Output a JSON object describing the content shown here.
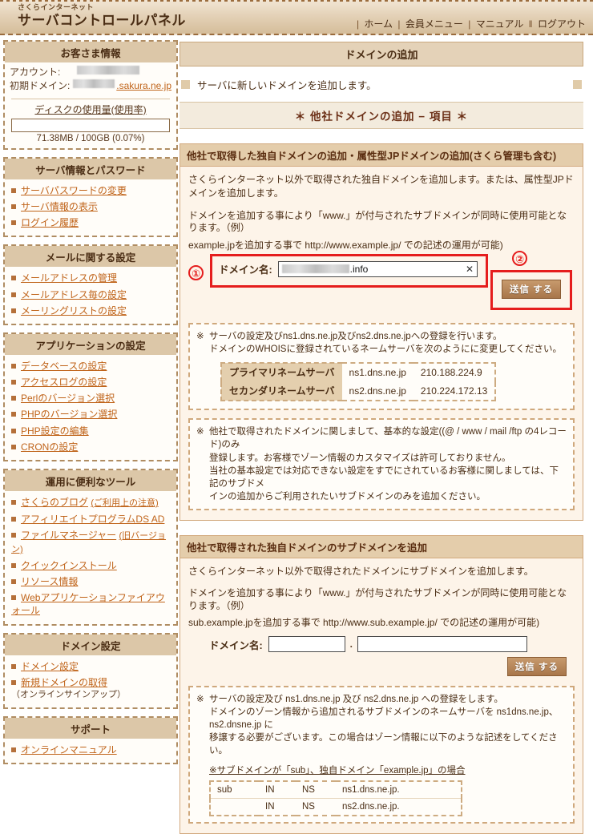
{
  "header": {
    "brand_small": "さくらインターネット",
    "brand_big": "サーバコントロールパネル",
    "nav": [
      {
        "label": "ホーム",
        "sep": "|"
      },
      {
        "label": "会員メニュー",
        "sep": "|"
      },
      {
        "label": "マニュアル",
        "sep": "|"
      },
      {
        "label": "ログアウト",
        "sep": "‖"
      }
    ]
  },
  "sidebar": {
    "customer": {
      "title": "お客さま情報",
      "account_label": "アカウント:",
      "account_value": "",
      "initial_domain_label": "初期ドメイン:",
      "initial_domain_value": "",
      "initial_domain_suffix": ".sakura.ne.jp",
      "disk_title": "ディスクの使用量(使用率)",
      "disk_text": "71.38MB / 100GB (0.07%)",
      "disk_percent": 0.07
    },
    "groups": [
      {
        "title": "サーバ情報とパスワード",
        "items": [
          {
            "label": "サーバパスワードの変更"
          },
          {
            "label": "サーバ情報の表示"
          },
          {
            "label": "ログイン履歴"
          }
        ]
      },
      {
        "title": "メールに関する設定",
        "items": [
          {
            "label": "メールアドレスの管理"
          },
          {
            "label": "メールアドレス毎の設定"
          },
          {
            "label": "メーリングリストの設定"
          }
        ]
      },
      {
        "title": "アプリケーションの設定",
        "items": [
          {
            "label": "データベースの設定"
          },
          {
            "label": "アクセスログの設定"
          },
          {
            "label": "Perlのバージョン選択"
          },
          {
            "label": "PHPのバージョン選択"
          },
          {
            "label": "PHP設定の編集"
          },
          {
            "label": "CRONの設定"
          }
        ]
      },
      {
        "title": "運用に便利なツール",
        "items": [
          {
            "label": "さくらのブログ",
            "note": "(ご利用上の注意)"
          },
          {
            "label": "アフィリエイトプログラムDS AD"
          },
          {
            "label": "ファイルマネージャー",
            "note": "(旧バージョン)"
          },
          {
            "label": "クイックインストール"
          },
          {
            "label": "リソース情報"
          },
          {
            "label": "Webアプリケーションファイアウォール"
          }
        ]
      },
      {
        "title": "ドメイン設定",
        "items": [
          {
            "label": "ドメイン設定"
          },
          {
            "label": "新規ドメインの取得",
            "note2": "（オンラインサインアップ）"
          }
        ]
      },
      {
        "title": "サポート",
        "items": [
          {
            "label": "オンラインマニュアル"
          }
        ]
      }
    ]
  },
  "main": {
    "page_title": "ドメインの追加",
    "lead_text": "サーバに新しいドメインを追加します。",
    "section_title": "＊ 他社ドメインの追加 − 項目 ＊",
    "box1": {
      "head": "他社で取得した独自ドメインの追加・属性型JPドメインの追加(さくら管理も含む)",
      "p1": "さくらインターネット以外で取得された独自ドメインを追加します。または、属性型JPドメインを追加します。",
      "p2_line1": "ドメインを追加する事により「www.」が付与されたサブドメインが同時に使用可能となります。（例）",
      "p2_line2": "example.jpを追加する事で http://www.example.jp/ での記述の運用が可能)",
      "marker1": "①",
      "marker2": "②",
      "domain_label": "ドメイン名:",
      "domain_value": ".info",
      "domain_clear_icon": "✕",
      "submit_label": "送信 する",
      "note1_mark": "※",
      "note1_line1": "サーバの設定及びns1.dns.ne.jp及びns2.dns.ne.jpへの登録を行います。",
      "note1_line2": "ドメインのWHOISに登録されているネームサーバを次のようにに変更してください。",
      "ns_rows": [
        {
          "k": "プライマリネームサーバ",
          "host": "ns1.dns.ne.jp",
          "ip": "210.188.224.9"
        },
        {
          "k": "セカンダリネームサーバ",
          "host": "ns2.dns.ne.jp",
          "ip": "210.224.172.13"
        }
      ],
      "note2_mark": "※",
      "note2_line1": "他社で取得されたドメインに関しまして、基本的な設定((@ / www / mail /ftp の4レコード)のみ",
      "note2_line2": "登録します。お客様でゾーン情報のカスタマイズは許可しておりません。",
      "note2_line3": "当社の基本設定では対応できない設定をすでにされているお客様に関しましては、下記のサブドメ",
      "note2_line4": "インの追加からご利用されたいサブドメインのみを追加ください。"
    },
    "box2": {
      "head": "他社で取得された独自ドメインのサブドメインを追加",
      "p1": "さくらインターネット以外で取得されたドメインにサブドメインを追加します。",
      "p2_line1": "ドメインを追加する事により「www.」が付与されたサブドメインが同時に使用可能となります。（例）",
      "p2_line2": "sub.example.jpを追加する事で http://www.sub.example.jp/ での記述の運用が可能)",
      "domain_label": "ドメイン名:",
      "sub_value": "",
      "sub_placeholder": "",
      "domain_value": "",
      "domain_placeholder": "",
      "separator": ".",
      "submit_label": "送信 する",
      "note_mark": "※",
      "note_line1": "サーバの設定及び ns1.dns.ne.jp 及び ns2.dns.ne.jp への登録をします。",
      "note_line2": "ドメインのゾーン情報から追加されるサブドメインのネームサーバを ns1dns.ne.jp、ns2.dnsne.jp に",
      "note_line3": "移譲する必要がございます。この場合はゾーン情報に以下のような記述をしてください。",
      "note_line4": "※サブドメインが「sub」、独自ドメイン「example.jp」の場合",
      "zone_rows": [
        {
          "c1": "sub",
          "c2": "IN",
          "c3": "NS",
          "c4": "ns1.dns.ne.jp."
        },
        {
          "c1": "",
          "c2": "IN",
          "c3": "NS",
          "c4": "ns2.dns.ne.jp."
        }
      ]
    }
  },
  "colors": {
    "accent_brown": "#a8764a",
    "link": "#c0641a",
    "panel_title_bg": "#dcc7a8",
    "annotation_red": "#e51d1d"
  }
}
